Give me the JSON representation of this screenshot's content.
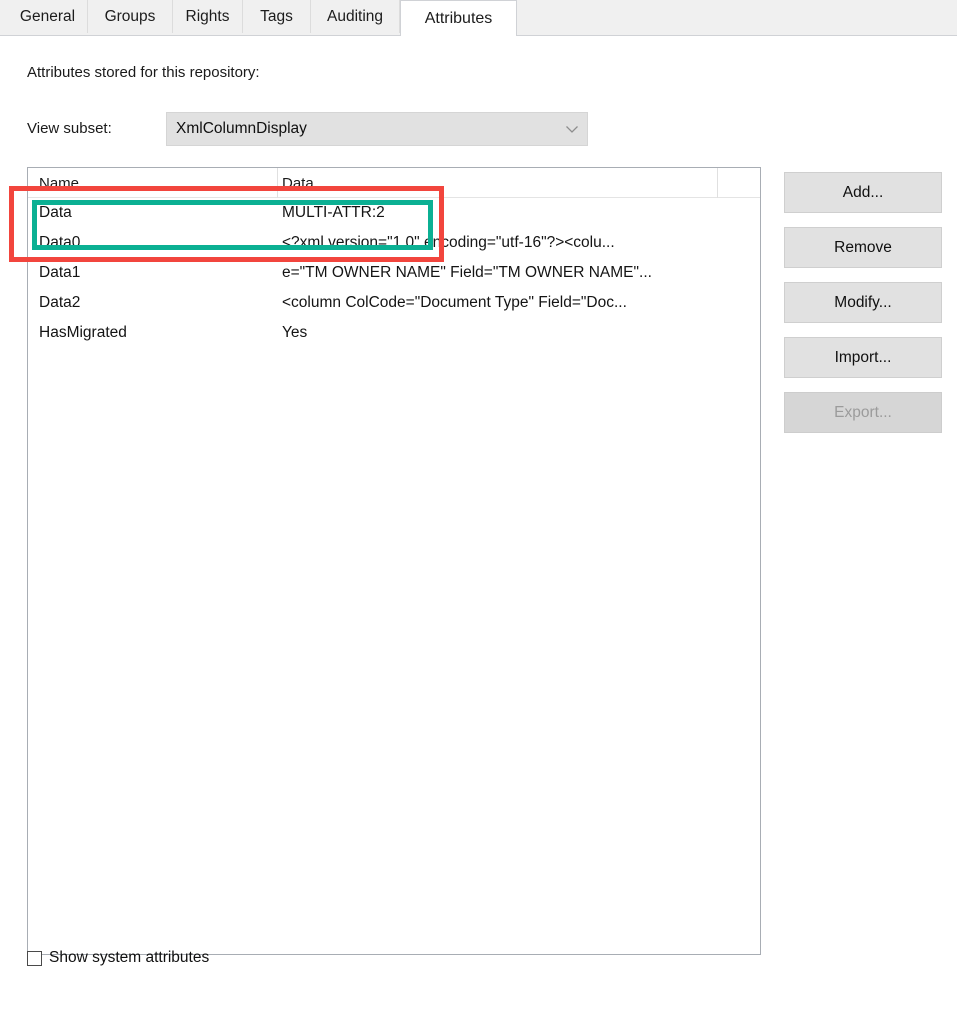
{
  "tabs": [
    {
      "label": "General",
      "active": false
    },
    {
      "label": "Groups",
      "active": false
    },
    {
      "label": "Rights",
      "active": false
    },
    {
      "label": "Tags",
      "active": false
    },
    {
      "label": "Auditing",
      "active": false
    },
    {
      "label": "Attributes",
      "active": true
    }
  ],
  "main": {
    "intro_label": "Attributes stored for this repository:",
    "subset_label": "View subset:",
    "subset_value": "XmlColumnDisplay",
    "subset_arrow_icon": "chevron-down-icon"
  },
  "list": {
    "columns": [
      "Name",
      "Data"
    ],
    "rows": [
      {
        "name": "Data",
        "data": "MULTI-ATTR:2"
      },
      {
        "name": "Data0",
        "data": "<?xml version=\"1.0\" encoding=\"utf-16\"?><colu..."
      },
      {
        "name": "Data1",
        "data": "e=\"TM OWNER NAME\" Field=\"TM OWNER NAME\"..."
      },
      {
        "name": "Data2",
        "data": "<column ColCode=\"Document Type\" Field=\"Doc..."
      },
      {
        "name": "HasMigrated",
        "data": "Yes"
      }
    ]
  },
  "buttons": [
    {
      "label": "Add...",
      "disabled": false
    },
    {
      "label": "Remove",
      "disabled": false
    },
    {
      "label": "Modify...",
      "disabled": false
    },
    {
      "label": "Import...",
      "disabled": false
    },
    {
      "label": "Export...",
      "disabled": true
    }
  ],
  "footer": {
    "show_system_attributes_label": "Show system attributes",
    "show_system_attributes_checked": false
  },
  "annotations": [
    {
      "name": "highlight-rect-outer",
      "color": "#f2453d"
    },
    {
      "name": "highlight-rect-inner",
      "color": "#0bb093"
    }
  ]
}
